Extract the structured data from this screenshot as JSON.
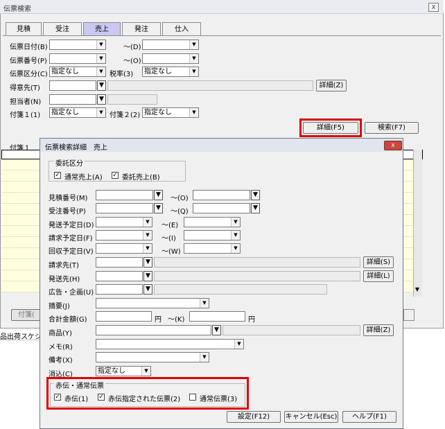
{
  "main": {
    "title": "伝票検索",
    "close": "X",
    "tabs": [
      {
        "label": "見積"
      },
      {
        "label": "受注"
      },
      {
        "label": "売上"
      },
      {
        "label": "発注"
      },
      {
        "label": "仕入"
      }
    ],
    "labels": {
      "date": "伝票日付(B)",
      "number": "伝票番号(P)",
      "kubun": "伝票区分(C)",
      "tax": "税率(3)",
      "tokui": "得意先(T)",
      "tanto": "担当者(N)",
      "fusen1": "付箋１(1)",
      "fusen2": "付箋２(2)",
      "range_d": "〜(D)",
      "range_o": "〜(O)"
    },
    "values": {
      "kubun": "指定なし",
      "tax": "指定なし",
      "fusen1": "指定なし",
      "fusen2": "指定なし"
    },
    "buttons": {
      "detail_z": "詳細(Z)",
      "detail_f5": "詳細(F5)",
      "search": "検索(F7)"
    },
    "grid_header": "付箋１",
    "bottom_btn": "付箋(",
    "status_text": "品出荷スケジュ"
  },
  "dialog": {
    "title": "伝票検索詳細　売上",
    "close": "x",
    "consign_group": "委託区分",
    "consign_normal": "通常売上(A)",
    "consign_trust": "委託売上(B)",
    "labels": {
      "mitsumori": "見積番号(M)",
      "juchu": "受注番号(P)",
      "hasso_date": "発送予定日(D)",
      "seikyu_date": "請求予定日(F)",
      "kaishu_date": "回収予定日(V)",
      "seikyu": "請求先(T)",
      "hasso": "発送先(H)",
      "kokoku": "広告・企画(U)",
      "tekiyo": "摘要(J)",
      "total": "合計金額(G)",
      "shohin": "商品(Y)",
      "memo": "メモ(R)",
      "biko": "備考(X)",
      "keshikomi": "消込(C)"
    },
    "ranges": {
      "o1": "〜(O)",
      "o2": "〜(Q)",
      "e": "〜(E)",
      "i": "〜(I)",
      "w": "〜(W)",
      "k": "〜(K)"
    },
    "yen": "円",
    "keshikomi_value": "指定なし",
    "detail_s": "詳細(S)",
    "detail_l": "詳細(L)",
    "detail_z": "詳細(Z)",
    "red_group": "赤伝・通常伝票",
    "red_aka": "赤伝(1)",
    "red_shitei": "赤伝指定された伝票(2)",
    "red_normal": "通常伝票(3)",
    "btn_ok": "設定(F12)",
    "btn_cancel": "キャンセル(Esc)",
    "btn_help": "ヘルプ(F1)",
    "check": "✓",
    "arrow": "▼"
  },
  "colors": {
    "highlight": "#e00000",
    "active_tab": "#c9c8f0",
    "grid_row": "#ffffe0"
  }
}
